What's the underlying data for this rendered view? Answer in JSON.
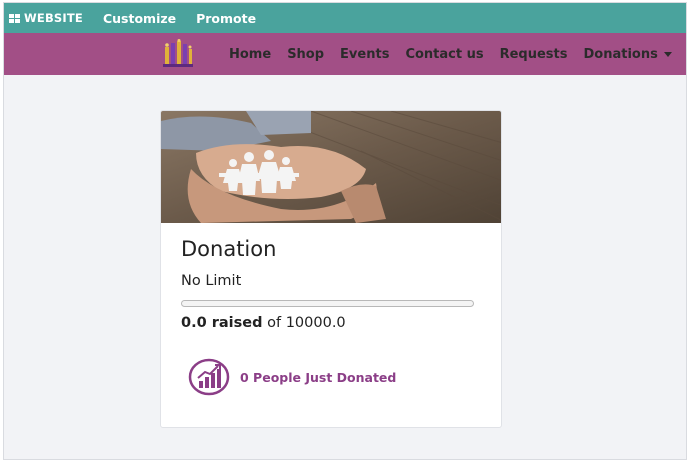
{
  "adminbar": {
    "brand": "WEBSITE",
    "items": [
      "Customize",
      "Promote"
    ]
  },
  "nav": {
    "links": [
      "Home",
      "Shop",
      "Events",
      "Contact us",
      "Requests"
    ],
    "dropdown": "Donations"
  },
  "card": {
    "title": "Donation",
    "limit": "No Limit",
    "raised_value": "0.0 raised",
    "raised_target": "of 10000.0",
    "progress_fraction": 0,
    "donors_text": "0 People Just Donated"
  },
  "colors": {
    "adminbar": "#4aa39d",
    "navbar": "#a24f86",
    "accent": "#8b3e87"
  }
}
